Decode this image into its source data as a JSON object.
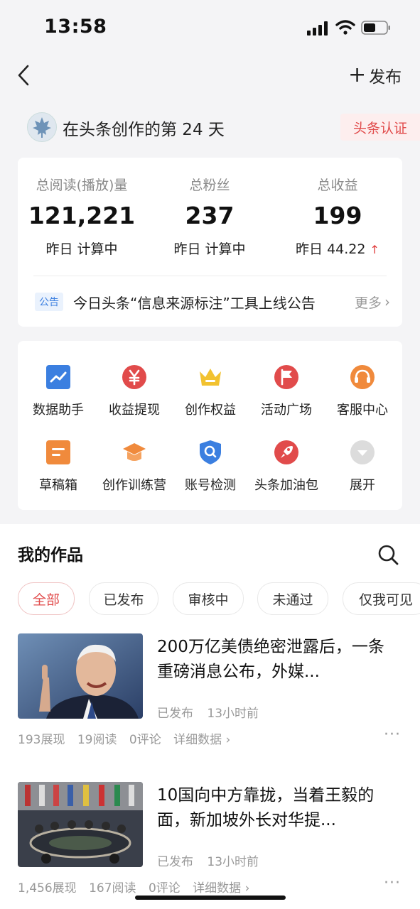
{
  "status_bar": {
    "time": "13:58"
  },
  "nav": {
    "publish_plus": "+",
    "publish_label": "发布"
  },
  "creator": {
    "days_text": "在头条创作的第 24 天",
    "cert_label": "头条认证"
  },
  "stats": [
    {
      "label": "总阅读(播放)量",
      "value": "121,221",
      "sub": "昨日 计算中"
    },
    {
      "label": "总粉丝",
      "value": "237",
      "sub": "昨日 计算中"
    },
    {
      "label": "总收益",
      "value": "199",
      "sub": "昨日 44.22",
      "trend": "↑"
    }
  ],
  "notice": {
    "tag": "公告",
    "text": "今日头条“信息来源标注”工具上线公告",
    "more": "更多",
    "chevron": "›"
  },
  "tools": [
    {
      "label": "数据助手",
      "icon": "chart-icon"
    },
    {
      "label": "收益提现",
      "icon": "yuan-icon"
    },
    {
      "label": "创作权益",
      "icon": "crown-icon"
    },
    {
      "label": "活动广场",
      "icon": "flag-icon"
    },
    {
      "label": "客服中心",
      "icon": "headset-icon"
    },
    {
      "label": "草稿箱",
      "icon": "draft-icon"
    },
    {
      "label": "创作训练营",
      "icon": "graduation-cap-icon"
    },
    {
      "label": "账号检测",
      "icon": "shield-search-icon"
    },
    {
      "label": "头条加油包",
      "icon": "rocket-icon"
    },
    {
      "label": "展开",
      "icon": "expand-icon"
    }
  ],
  "works": {
    "title": "我的作品",
    "filters": [
      "全部",
      "已发布",
      "审核中",
      "未通过",
      "仅我可见"
    ],
    "active_filter": "全部",
    "articles": [
      {
        "title": "200万亿美债绝密泄露后，一条重磅消息公布，外媒...",
        "status": "已发布",
        "time": "13小时前",
        "impressions": "193展现",
        "reads": "19阅读",
        "comments": "0评论",
        "details": "详细数据 ›"
      },
      {
        "title": "10国向中方靠拢，当着王毅的面，新加坡外长对华提...",
        "status": "已发布",
        "time": "13小时前",
        "impressions": "1,456展现",
        "reads": "167阅读",
        "comments": "0评论",
        "details": "详细数据 ›"
      }
    ],
    "more_glyph": "···"
  },
  "colors": {
    "accent_red": "#e14b4b",
    "blue": "#3b7fe0",
    "orange": "#f08a3c",
    "gold": "#f2c230"
  }
}
